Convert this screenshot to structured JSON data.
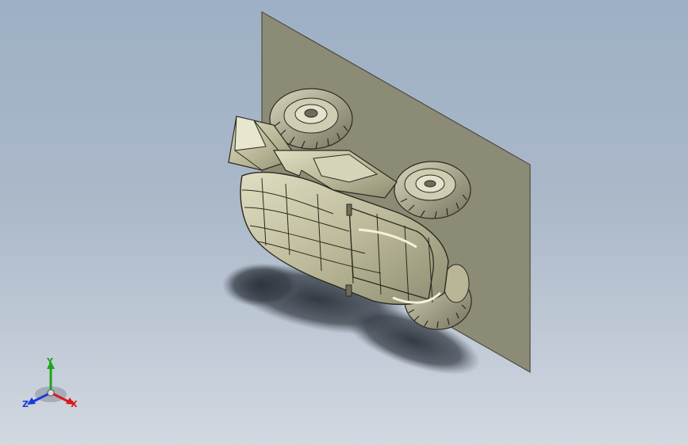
{
  "viewport": {
    "background_top": "#9eb0c6",
    "background_bottom": "#d2d8e0"
  },
  "model": {
    "name_hint": "dune-buggy",
    "shading": "shaded-with-edges",
    "plane_color": "#8c8b76",
    "body_color": "#c4c2a2",
    "tire_color": "#9a987e"
  },
  "triad": {
    "y_label": "Y",
    "z_label": "Z",
    "x_label": "X",
    "y_color": "#1fa31f",
    "z_color": "#1a3cd8",
    "x_color": "#d81a1a"
  }
}
